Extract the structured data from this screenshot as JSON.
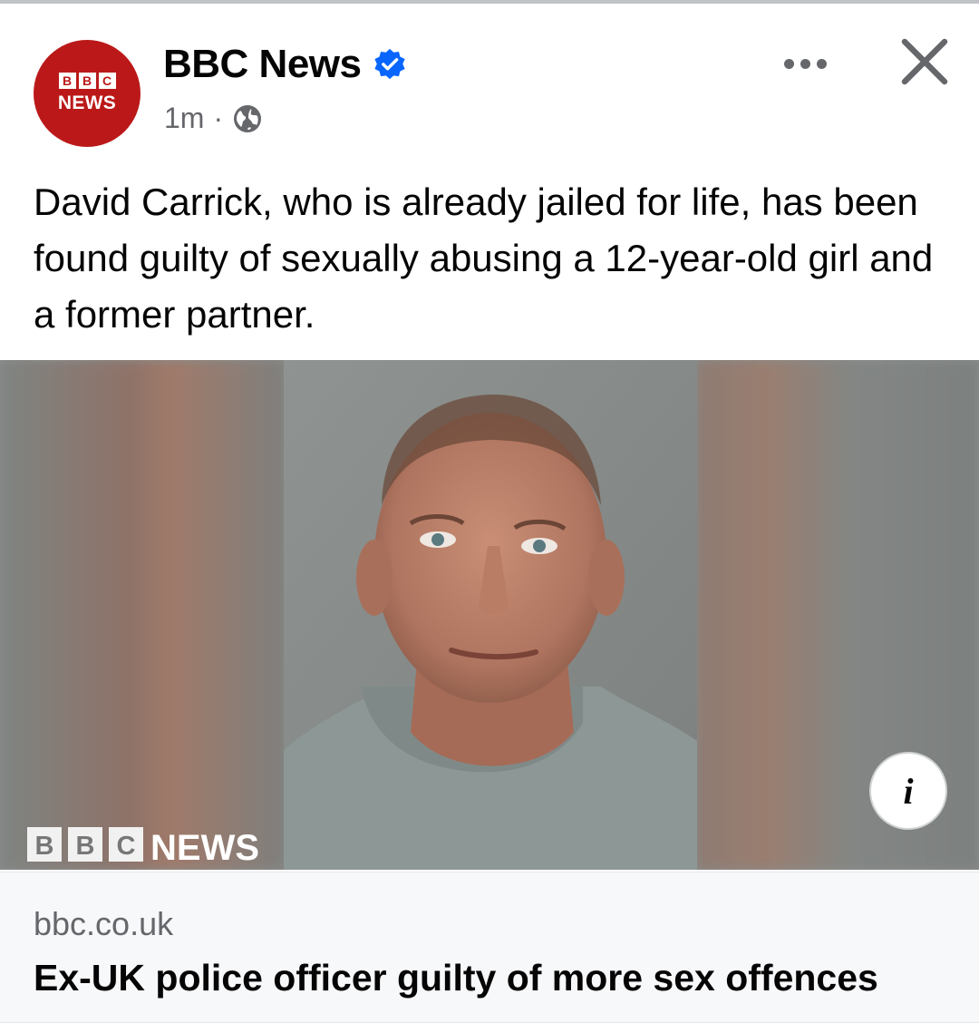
{
  "post": {
    "page_name": "BBC News",
    "avatar": {
      "blocks": [
        "B",
        "B",
        "C"
      ],
      "word": "NEWS",
      "color": "#bb1919"
    },
    "timestamp": "1m",
    "separator": "·",
    "audience_icon": "globe-icon",
    "verified_icon": "verified-badge-icon",
    "more_icon": "more-options-icon",
    "close_icon": "close-icon",
    "caption": "David Carrick, who is already jailed for life, has been found guilty of sexually abusing a 12-year-old girl and a former partner."
  },
  "image": {
    "info_label": "i",
    "watermark": {
      "blocks": [
        "B",
        "B",
        "C"
      ],
      "word": "NEWS"
    }
  },
  "link_preview": {
    "domain": "bbc.co.uk",
    "headline": "Ex-UK police officer guilty of more sex offences"
  },
  "colors": {
    "brand_red": "#bb1919",
    "verified_blue": "#0866ff",
    "text_primary": "#050505",
    "text_secondary": "#65676b"
  }
}
